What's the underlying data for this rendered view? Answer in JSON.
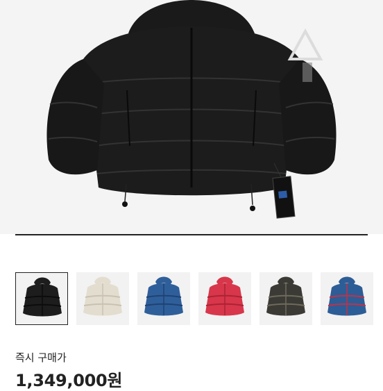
{
  "hero": {
    "image": "black puffer jacket with hood and hang tag",
    "carousel_progress": 1.0
  },
  "colors": {
    "jacket_black": "#1c1c1c",
    "accent": "#222222",
    "track": "#e2e2e2"
  },
  "thumbnails": [
    {
      "name": "black",
      "color": "#1d1d1d",
      "shade": "#0c0c0c",
      "selected": true
    },
    {
      "name": "cream",
      "color": "#e3ddd0",
      "shade": "#c9c1b1",
      "selected": false
    },
    {
      "name": "blue",
      "color": "#2f5f9a",
      "shade": "#1f4272",
      "selected": false
    },
    {
      "name": "red",
      "color": "#d8364a",
      "shade": "#aa2335",
      "selected": false
    },
    {
      "name": "camo",
      "color": "#3b3a35",
      "shade": "#6f6b5c",
      "selected": false
    },
    {
      "name": "patchwork",
      "color": "#2d5d96",
      "shade": "#c23148",
      "selected": false
    }
  ],
  "price": {
    "label": "즉시 구매가",
    "value": "1,349,000원"
  }
}
